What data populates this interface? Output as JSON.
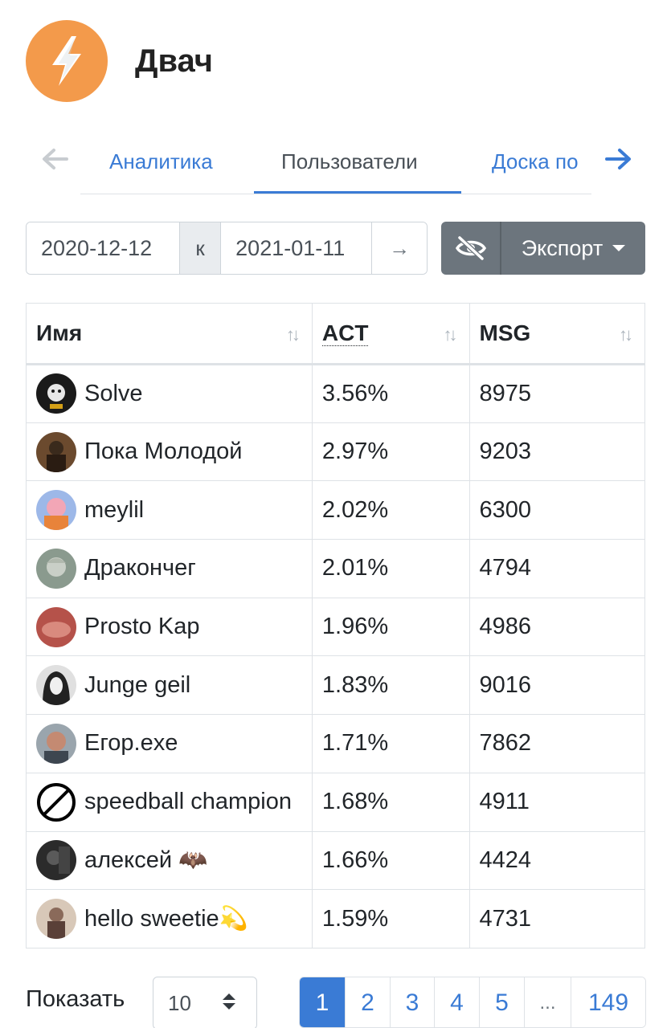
{
  "header": {
    "title": "Двач",
    "logo_color": "#f39a4b"
  },
  "tabs": {
    "items": [
      "Аналитика",
      "Пользователи",
      "Доска по"
    ],
    "active_index": 1
  },
  "filters": {
    "date_from": "2020-12-12",
    "date_separator": "к",
    "date_to": "2021-01-11",
    "go_label": "→",
    "export_label": "Экспорт"
  },
  "table": {
    "headers": [
      "Имя",
      "ACT",
      "MSG"
    ],
    "rows": [
      {
        "name": "Solve",
        "act": "3.56%",
        "msg": "8975"
      },
      {
        "name": "Пока Молодой",
        "act": "2.97%",
        "msg": "9203"
      },
      {
        "name": "meylil",
        "act": "2.02%",
        "msg": "6300"
      },
      {
        "name": "Дракончег",
        "act": "2.01%",
        "msg": "4794"
      },
      {
        "name": "Prosto Kap",
        "act": "1.96%",
        "msg": "4986"
      },
      {
        "name": "Junge geil",
        "act": "1.83%",
        "msg": "9016"
      },
      {
        "name": "Егор.exe",
        "act": "1.71%",
        "msg": "7862"
      },
      {
        "name": "speedball champion",
        "act": "1.68%",
        "msg": "4911"
      },
      {
        "name": "алексей 🦇",
        "act": "1.66%",
        "msg": "4424"
      },
      {
        "name": "hello sweetie💫",
        "act": "1.59%",
        "msg": "4731"
      }
    ]
  },
  "footer": {
    "show_label": "Показать",
    "page_size": "10",
    "pages": [
      "1",
      "2",
      "3",
      "4",
      "5",
      "...",
      "149"
    ],
    "active_page": "1"
  },
  "colors": {
    "accent": "#3a7bd5",
    "secondary_button": "#6c757d"
  }
}
